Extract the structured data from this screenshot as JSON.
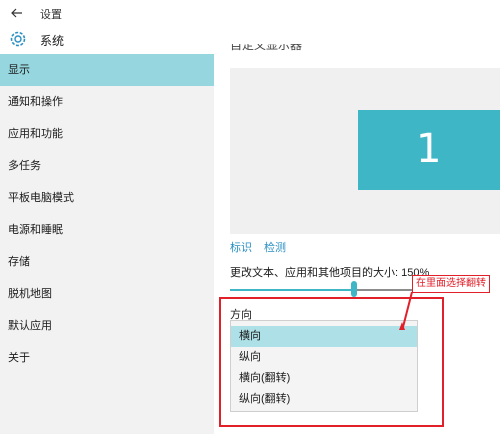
{
  "window": {
    "title": "设置"
  },
  "header": {
    "title": "系统"
  },
  "sidebar": {
    "items": [
      {
        "label": "显示",
        "active": true
      },
      {
        "label": "通知和操作"
      },
      {
        "label": "应用和功能"
      },
      {
        "label": "多任务"
      },
      {
        "label": "平板电脑模式"
      },
      {
        "label": "电源和睡眠"
      },
      {
        "label": "存储"
      },
      {
        "label": "脱机地图"
      },
      {
        "label": "默认应用"
      },
      {
        "label": "关于"
      }
    ]
  },
  "main": {
    "clipped_heading": "自定义显示器",
    "display_number": "1",
    "links": {
      "identify": "标识",
      "detect": "检测"
    },
    "scale_label": "更改文本、应用和其他项目的大小: 150%",
    "scale_slider_fraction": 0.63,
    "orientation_label": "方向",
    "orientation_options": [
      "横向",
      "纵向",
      "横向(翻转)",
      "纵向(翻转)"
    ],
    "selected_option": "横向"
  },
  "annotation": {
    "text": "在里面选择翻转",
    "color": "#e1202a"
  },
  "colors": {
    "accent": "#3fb6c6",
    "selection": "#96d7df",
    "link": "#2a8fc2"
  }
}
